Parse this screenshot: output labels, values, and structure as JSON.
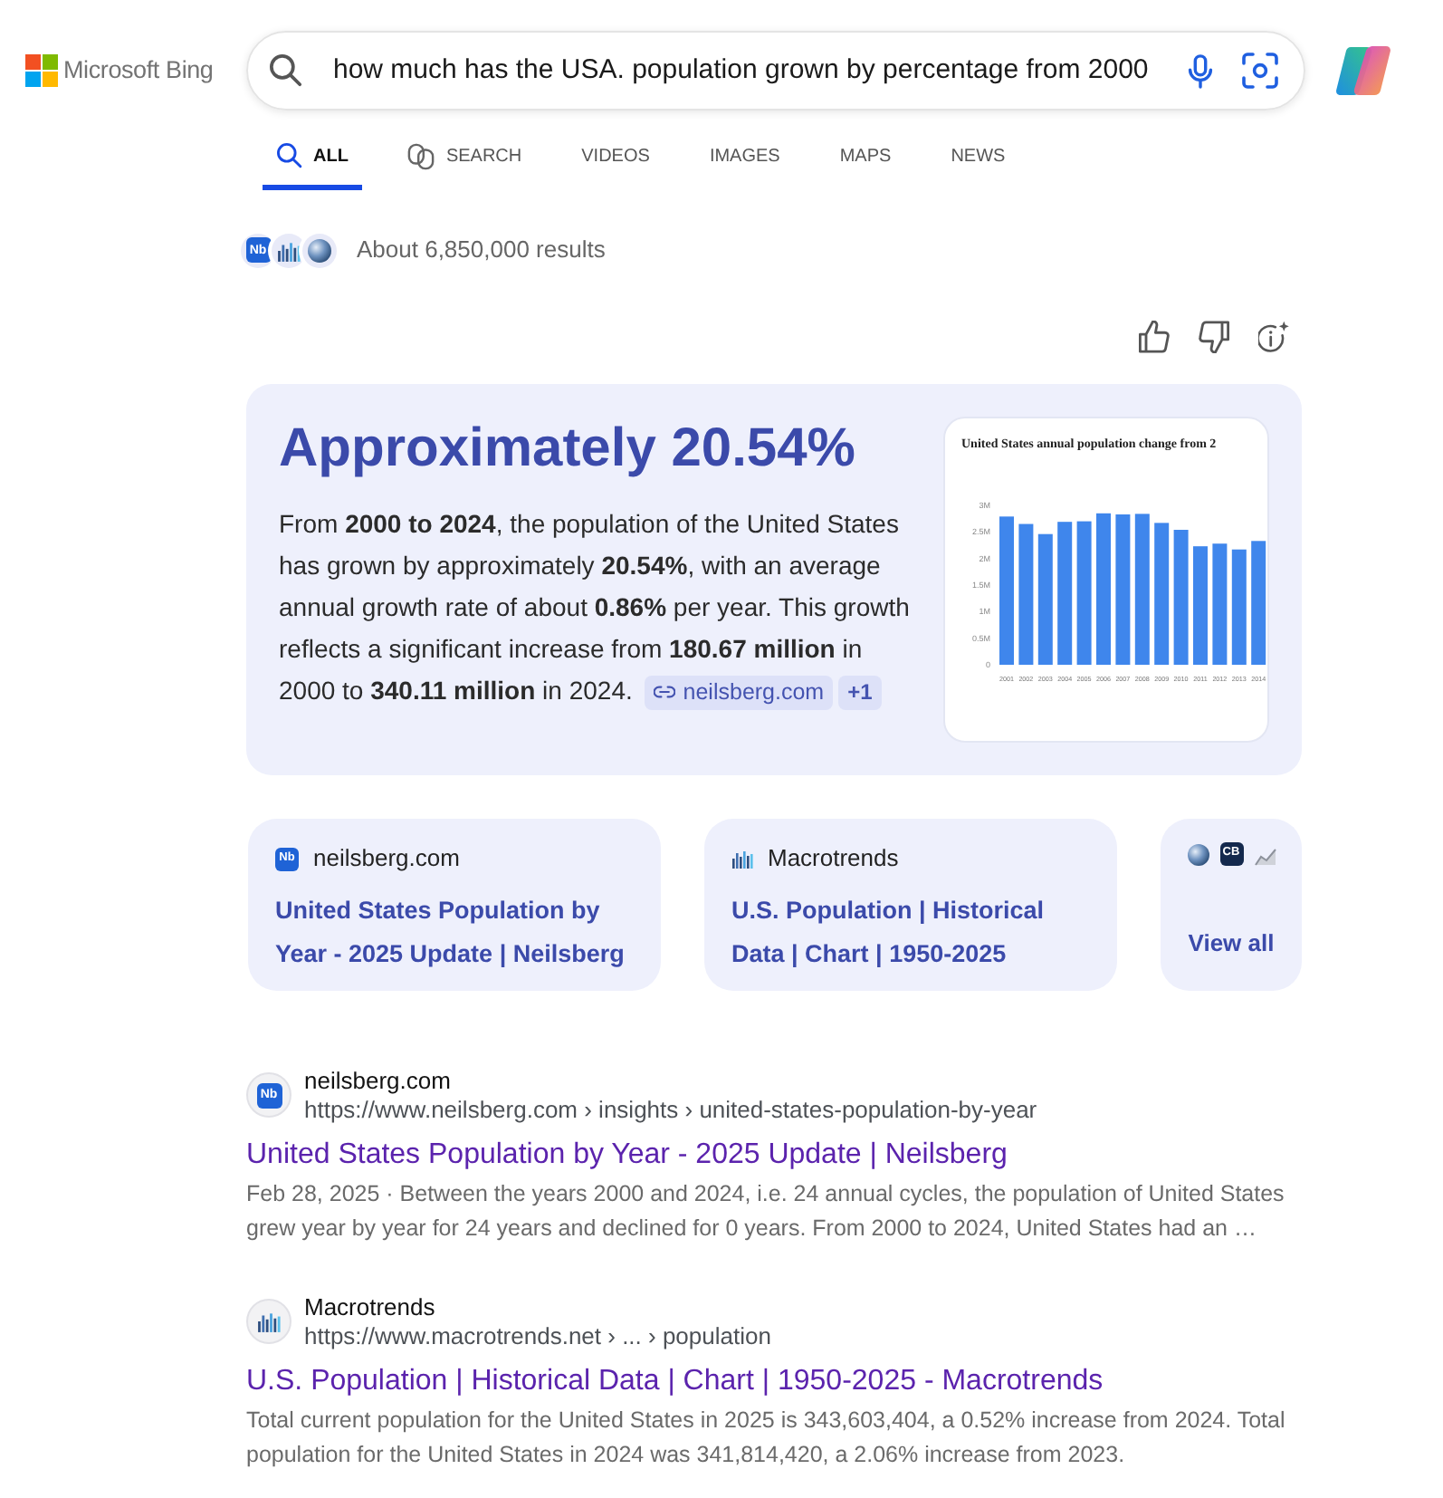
{
  "header": {
    "logo_text": "Microsoft Bing",
    "search": {
      "value": "how much has the USA. population grown by percentage from 2000"
    }
  },
  "tabs": [
    {
      "label": "ALL",
      "selected": true
    },
    {
      "label": "SEARCH",
      "selected": false
    },
    {
      "label": "VIDEOS",
      "selected": false
    },
    {
      "label": "IMAGES",
      "selected": false
    },
    {
      "label": "MAPS",
      "selected": false
    },
    {
      "label": "NEWS",
      "selected": false
    }
  ],
  "results_summary": {
    "sources": [
      {
        "kind": "letters",
        "text": "Nb",
        "color": "#1f63d6"
      },
      {
        "kind": "bars"
      },
      {
        "kind": "globe"
      }
    ],
    "count": "About 6,850,000 results"
  },
  "answer": {
    "heading": "Approximately 20.54%",
    "text": "From **2000 to 2024**, the population of the United States has grown by approximately **20.54%**, with an average annual growth rate of about **0.86%** per year. This growth reflects a significant increase from **180.67 million** in 2000 to **340.11 million** in 2024.",
    "source_chip": "neilsberg.com",
    "more_chip": "+1",
    "thumbnail": {
      "chart_data": {
        "type": "bar",
        "title": "United States annual population change from 2",
        "categories": [
          "2001",
          "2002",
          "2003",
          "2004",
          "2005",
          "2006",
          "2007",
          "2008",
          "2009",
          "2010",
          "2011",
          "2012",
          "2013",
          "2014"
        ],
        "values": [
          2.79,
          2.65,
          2.46,
          2.69,
          2.7,
          2.85,
          2.83,
          2.84,
          2.67,
          2.54,
          2.23,
          2.28,
          2.17,
          2.33
        ],
        "ylim": [
          0,
          3
        ],
        "yticks": [
          {
            "value": 3,
            "label": "3M"
          },
          {
            "value": 2.5,
            "label": "2.5M"
          },
          {
            "value": 2,
            "label": "2M"
          },
          {
            "value": 1.5,
            "label": "1.5M"
          },
          {
            "value": 1,
            "label": "1M"
          },
          {
            "value": 0.5,
            "label": "0.5M"
          },
          {
            "value": 0,
            "label": "0"
          }
        ]
      }
    }
  },
  "source_cards": [
    {
      "favicon": {
        "kind": "letters",
        "text": "Nb",
        "color": "#1f63d6"
      },
      "site": "neilsberg.com",
      "title": "United States Population by Year - 2025 Update | Neilsberg"
    },
    {
      "favicon": {
        "kind": "bars"
      },
      "site": "Macrotrends",
      "title": "U.S. Population | Historical Data | Chart | 1950-2025"
    }
  ],
  "view_all": {
    "icons": [
      {
        "kind": "globe"
      },
      {
        "kind": "letters",
        "text": "CB",
        "color": "#14294d"
      },
      {
        "kind": "chart"
      }
    ],
    "label": "View all"
  },
  "results": [
    {
      "favicon": {
        "kind": "letters",
        "text": "Nb",
        "color": "#1f63d6"
      },
      "site": "neilsberg.com",
      "url": "https://www.neilsberg.com › insights › united-states-population-by-year",
      "title": "United States Population by Year - 2025 Update | Neilsberg",
      "snippet": "Feb 28, 2025 · Between the years 2000 and 2024, i.e. 24 annual cycles, the population of United States grew year by year for 24 years and declined for 0 years. From 2000 to 2024, United States had an …"
    },
    {
      "favicon": {
        "kind": "bars"
      },
      "site": "Macrotrends",
      "url": "https://www.macrotrends.net › ... › population",
      "title": "U.S. Population | Historical Data | Chart | 1950-2025 - Macrotrends",
      "snippet": "Total current population for the United States in 2025 is 343,603,404, a 0.52% increase from 2024. Total population for the United States in 2024 was 341,814,420, a 2.06% increase from 2023."
    }
  ]
}
